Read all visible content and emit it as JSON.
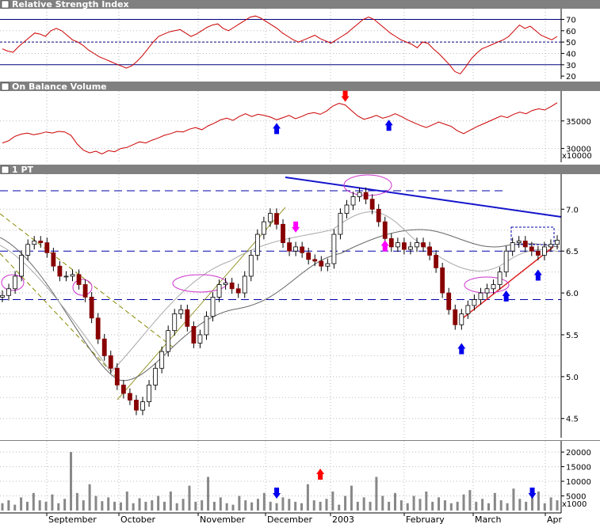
{
  "chart_data": [
    {
      "type": "line",
      "title": "Relative Strength Index",
      "y_ticks": [
        70,
        60,
        50,
        40,
        30,
        20
      ],
      "ylim": [
        18,
        78
      ],
      "reference_lines": [
        70,
        50,
        30
      ],
      "colors": {
        "line": "#cc0000",
        "reference": "#000080"
      },
      "series": [
        {
          "values": [
            44,
            42,
            41,
            46,
            50,
            54,
            58,
            57,
            55,
            60,
            62,
            60,
            56,
            52,
            50,
            47,
            43,
            40,
            37,
            35,
            33,
            31,
            29,
            27,
            29,
            33,
            38,
            44,
            50,
            55,
            57,
            59,
            60,
            61,
            58,
            55,
            57,
            60,
            63,
            65,
            66,
            62,
            60,
            63,
            66,
            69,
            72,
            73,
            71,
            68,
            65,
            62,
            58,
            55,
            52,
            50,
            52,
            54,
            56,
            53,
            51,
            49,
            52,
            55,
            58,
            62,
            66,
            70,
            72,
            70,
            66,
            62,
            58,
            55,
            52,
            50,
            48,
            45,
            50,
            49,
            44,
            40,
            35,
            30,
            24,
            22,
            28,
            35,
            40,
            44,
            46,
            48,
            50,
            52,
            55,
            60,
            65,
            62,
            64,
            60,
            56,
            54,
            52,
            55
          ]
        }
      ]
    },
    {
      "type": "line",
      "title": "On Balance Volume",
      "y_ticks": [
        35000,
        30000
      ],
      "ylim": [
        28500,
        40000
      ],
      "unit_label": "x10000",
      "colors": {
        "line": "#cc0000"
      },
      "series": [
        {
          "values": [
            31000,
            31400,
            32200,
            32600,
            32800,
            32500,
            32700,
            33000,
            32800,
            33100,
            33000,
            32400,
            30800,
            29700,
            29200,
            29500,
            29000,
            29600,
            29400,
            30000,
            30200,
            30700,
            31200,
            31000,
            31500,
            31900,
            32400,
            32700,
            33100,
            33000,
            33500,
            33800,
            33400,
            34100,
            34600,
            35200,
            35500,
            35100,
            35800,
            36300,
            35800,
            36200,
            36000,
            35700,
            35200,
            35600,
            36000,
            35400,
            35800,
            36300,
            36500,
            36200,
            36800,
            37700,
            38200,
            37900,
            36900,
            35900,
            35300,
            35600,
            36000,
            35500,
            35800,
            36300,
            35800,
            35200,
            34700,
            34200,
            33800,
            34300,
            34800,
            34400,
            34000,
            33200,
            32700,
            33300,
            33900,
            34400,
            34900,
            35400,
            35900,
            35600,
            36200,
            36600,
            36300,
            36900,
            37200,
            37000,
            37600,
            38300
          ]
        }
      ],
      "annotations": [
        {
          "shape": "arrow-up",
          "color": "#0000ee",
          "x_index": 44
        },
        {
          "shape": "arrow-down",
          "color": "#ff0000",
          "x_index": 55
        },
        {
          "shape": "arrow-up",
          "color": "#0000ee",
          "x_index": 62
        }
      ]
    },
    {
      "type": "candlestick",
      "title": "1 PT",
      "y_ticks": [
        7.0,
        6.5,
        6.0,
        5.5,
        5.0,
        4.5
      ],
      "ylim": [
        4.28,
        7.4
      ],
      "colors": {
        "up": "#ffffff",
        "down": "#880000",
        "wick": "#000000",
        "trendline": "#1515cc",
        "support": "#dd2222",
        "ellipse": "#cc33cc",
        "dashed": "#0000aa",
        "moving_average": "#666666"
      },
      "horizontal_dashed_levels": [
        7.22,
        6.5,
        5.92
      ],
      "series": [
        {
          "name": "",
          "open": [
            5.95,
            5.97,
            6.05,
            6.2,
            6.45,
            6.58,
            6.62,
            6.6,
            6.48,
            6.32,
            6.2,
            6.2,
            6.22,
            6.1,
            5.95,
            5.7,
            5.45,
            5.25,
            5.1,
            4.9,
            4.8,
            4.72,
            4.6,
            4.7,
            4.9,
            5.1,
            5.3,
            5.55,
            5.75,
            5.8,
            5.6,
            5.4,
            5.5,
            5.72,
            5.95,
            6.1,
            6.12,
            6.05,
            6.0,
            6.2,
            6.45,
            6.7,
            6.85,
            6.95,
            6.82,
            6.6,
            6.5,
            6.55,
            6.48,
            6.4,
            6.38,
            6.32,
            6.35,
            6.7,
            6.95,
            7.05,
            7.15,
            7.2,
            7.12,
            7.0,
            6.85,
            6.65,
            6.55,
            6.6,
            6.52,
            6.55,
            6.6,
            6.55,
            6.45,
            6.3,
            6.0,
            5.8,
            5.62,
            5.75,
            5.85,
            5.92,
            6.0,
            6.05,
            6.1,
            6.25,
            6.5,
            6.6,
            6.62,
            6.55,
            6.5,
            6.45,
            6.55,
            6.58
          ]
        }
      ],
      "x_month_labels": [
        "September",
        "October",
        "November",
        "December",
        "2003",
        "February",
        "March",
        "Apr"
      ],
      "annotations": [
        {
          "shape": "arrow-down",
          "color": "#ff00ff",
          "x_index": 46
        },
        {
          "shape": "arrow-up",
          "color": "#ff00ff",
          "x_index": 60
        },
        {
          "shape": "arrow-up",
          "color": "#0000ee",
          "x_index": 72
        },
        {
          "shape": "arrow-up",
          "color": "#0000ee",
          "x_index": 79
        },
        {
          "shape": "arrow-up",
          "color": "#0000ee",
          "x_index": 84
        }
      ]
    },
    {
      "type": "bar",
      "title": "",
      "y_ticks": [
        20000,
        15000,
        10000,
        5000
      ],
      "ylim": [
        0,
        23000
      ],
      "unit_label": "x1000",
      "colors": {
        "bar": "#888888"
      },
      "series": [
        {
          "values": [
            2500,
            3500,
            2000,
            4500,
            3000,
            6000,
            3500,
            3000,
            5500,
            2500,
            4000,
            20000,
            6000,
            3500,
            9000,
            5000,
            3200,
            4500,
            3000,
            2800,
            6500,
            2500,
            4200,
            3000,
            3500,
            5000,
            3000,
            6500,
            2500,
            4000,
            8500,
            3000,
            3500,
            11500,
            3000,
            4500,
            2500,
            2000,
            5000,
            3500,
            2800,
            4000,
            6000,
            3000,
            2500,
            4500,
            4000,
            3000,
            2500,
            9000,
            3500,
            3000,
            4000,
            6500,
            2000,
            5000,
            8500,
            3000,
            4500,
            3000,
            11500,
            5000,
            3000,
            6000,
            3500,
            2500,
            5000,
            4000,
            6500,
            3000,
            4500,
            3500,
            2500,
            3000,
            5500,
            7000,
            3000,
            4000,
            2500,
            6000,
            3500,
            2500,
            7500,
            4000,
            3000,
            5000,
            6500,
            2500,
            4500,
            3500
          ]
        }
      ],
      "annotations": [
        {
          "shape": "arrow-down",
          "color": "#0000ee",
          "x_index": 44
        },
        {
          "shape": "arrow-up",
          "color": "#ff0000",
          "x_index": 51
        },
        {
          "shape": "arrow-down",
          "color": "#0000ee",
          "x_index": 85
        }
      ]
    }
  ]
}
